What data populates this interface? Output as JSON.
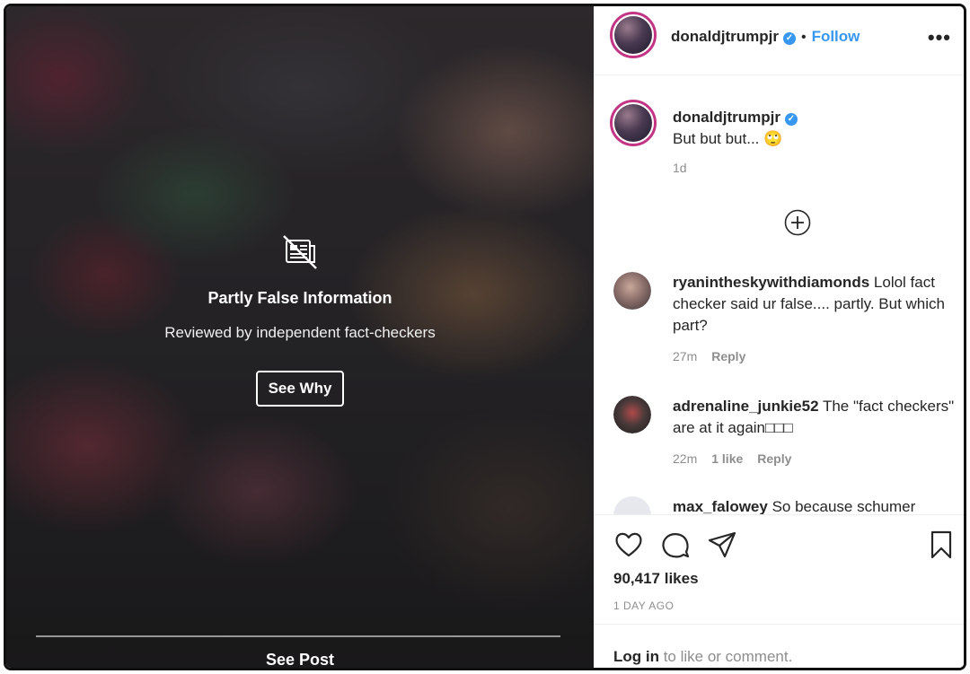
{
  "post": {
    "overlay": {
      "icon": "fact-check-icon",
      "title": "Partly False Information",
      "subtitle": "Reviewed by independent fact-checkers",
      "see_why": "See Why",
      "see_post": "See Post"
    }
  },
  "header": {
    "username": "donaldjtrumpjr",
    "separator": "•",
    "follow": "Follow",
    "more": "•••"
  },
  "caption": {
    "username": "donaldjtrumpjr",
    "text": "But but but... 🙄",
    "time": "1d"
  },
  "comments": [
    {
      "username": "ryanintheskywithdiamonds",
      "text": "Lolol fact checker said ur false.... partly. But which part?",
      "time": "27m",
      "reply": "Reply"
    },
    {
      "username": "adrenaline_junkie52",
      "text": "The \"fact checkers\" are at it again□□□",
      "time": "22m",
      "likes": "1 like",
      "reply": "Reply"
    },
    {
      "username": "max_falowey",
      "text": "So because schumer"
    }
  ],
  "actions": {
    "likes": "90,417 likes",
    "posted_ago": "1 DAY AGO",
    "login_link": "Log in",
    "login_rest": " to like or comment."
  },
  "colors": {
    "accent": "#3897f0",
    "story_ring": "#c13584",
    "muted": "#8e8e8e",
    "text": "#262626"
  }
}
